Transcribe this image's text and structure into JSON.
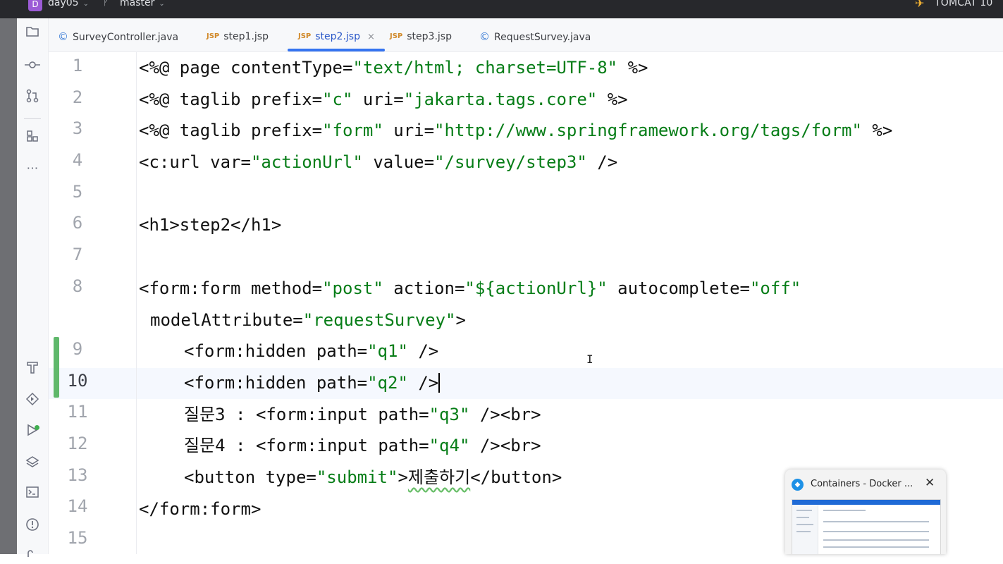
{
  "titlebar": {
    "project_badge": "D",
    "project": "day05",
    "branch": "master",
    "run_config": "TOMCAT 10"
  },
  "tabs": [
    {
      "label": "SurveyController.java",
      "icon": "class-icon",
      "active": false
    },
    {
      "label": "step1.jsp",
      "icon": "jsp-icon",
      "active": false
    },
    {
      "label": "step2.jsp",
      "icon": "jsp-icon",
      "active": true
    },
    {
      "label": "step3.jsp",
      "icon": "jsp-icon",
      "active": false
    },
    {
      "label": "RequestSurvey.java",
      "icon": "class-icon",
      "active": false
    }
  ],
  "tab_icon_text": {
    "class": "©",
    "jsp": "JSP",
    "close": "×"
  },
  "line_numbers": [
    "1",
    "2",
    "3",
    "4",
    "5",
    "6",
    "7",
    "8",
    "9",
    "10",
    "11",
    "12",
    "13",
    "14",
    "15"
  ],
  "current_line": "10",
  "code": {
    "l1": [
      "<%@ page contentType=",
      "\"text/html; charset=UTF-8\"",
      " %>"
    ],
    "l2": [
      "<%@ taglib prefix=",
      "\"c\"",
      " uri=",
      "\"jakarta.tags.core\"",
      " %>"
    ],
    "l3": [
      "<%@ taglib prefix=",
      "\"form\"",
      " uri=",
      "\"http://www.springframework.org/tags/form\"",
      " %>"
    ],
    "l4": [
      "<c:url var=",
      "\"actionUrl\"",
      " value=",
      "\"/survey/step3\"",
      " />"
    ],
    "l6": [
      "<h1>step2</h1>"
    ],
    "l8a": [
      "<form:form method=",
      "\"post\"",
      " action=",
      "\"${actionUrl}\"",
      " autocomplete=",
      "\"off\""
    ],
    "l8b": [
      "modelAttribute=",
      "\"requestSurvey\"",
      ">"
    ],
    "l9": [
      "<form:hidden path=",
      "\"q1\"",
      " />"
    ],
    "l10": [
      "<form:hidden path=",
      "\"q2\"",
      " />"
    ],
    "l11": [
      "질문3 : <form:input path=",
      "\"q3\"",
      " /><br>"
    ],
    "l12": [
      "질문4 : <form:input path=",
      "\"q4\"",
      " /><br>"
    ],
    "l13": [
      "<button type=",
      "\"submit\"",
      ">",
      "제출하기",
      "</button>"
    ],
    "l14": [
      "</form:form>"
    ]
  },
  "popup": {
    "title": "Containers - Docker ...",
    "icon": "docker-icon",
    "close": "✕"
  },
  "colors": {
    "string": "#067d17",
    "active_tab": "#3574f0",
    "modified_marker": "#5fb86b"
  }
}
